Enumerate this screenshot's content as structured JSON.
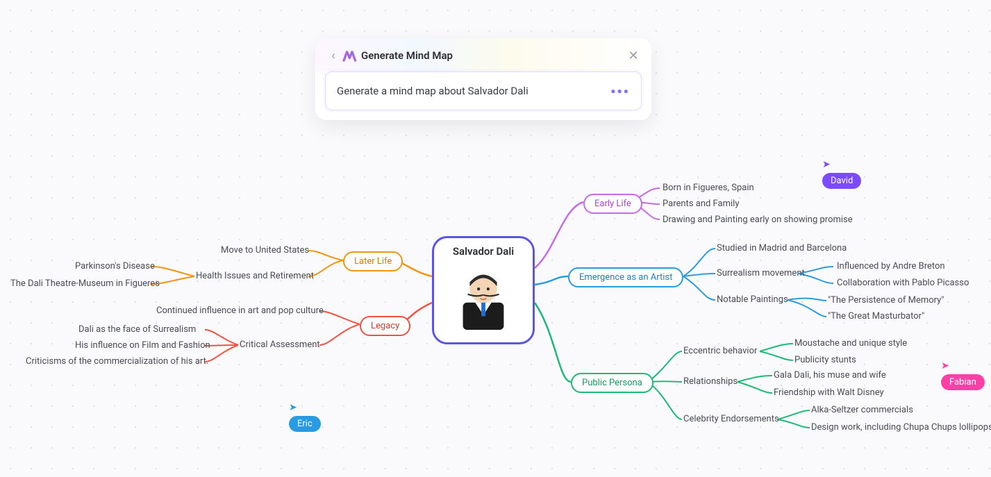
{
  "panel": {
    "title": "Generate Mind Map",
    "prompt": "Generate a mind map about Salvador Dali"
  },
  "center": {
    "title": "Salvador Dali"
  },
  "branches": {
    "early_life": {
      "label": "Early Life",
      "items": [
        "Born in Figueres, Spain",
        "Parents and Family",
        "Drawing and Painting early on showing promise"
      ]
    },
    "emergence": {
      "label": "Emergence as an Artist",
      "items": [
        "Studied in Madrid and Barcelona",
        "Surrealism movement",
        "Notable Paintings"
      ],
      "surrealism_sub": [
        "Influenced by Andre Breton",
        "Collaboration with Pablo Picasso"
      ],
      "paintings_sub": [
        "\"The Persistence of Memory\"",
        "\"The Great Masturbator\""
      ]
    },
    "public_persona": {
      "label": "Public Persona",
      "items": [
        "Eccentric behavior",
        "Relationships",
        "Celebrity Endorsements"
      ],
      "eccentric_sub": [
        "Moustache and unique style",
        "Publicity stunts"
      ],
      "relationships_sub": [
        "Gala Dali, his muse and wife",
        "Friendship with Walt Disney"
      ],
      "endorsements_sub": [
        "Alka-Seltzer commercials",
        "Design work, including Chupa Chups lollipops"
      ]
    },
    "later_life": {
      "label": "Later Life",
      "items": [
        "Move to United States",
        "Health Issues and Retirement"
      ],
      "health_sub": [
        "Parkinson's Disease",
        "The Dali Theatre-Museum in Figueres"
      ]
    },
    "legacy": {
      "label": "Legacy",
      "items": [
        "Continued influence in art and pop culture",
        "Critical Assessment"
      ],
      "critical_sub": [
        "Dali as the face of Surrealism",
        "His influence on Film and Fashion",
        "Criticisms of the commercialization of his art."
      ]
    }
  },
  "cursors": {
    "david": {
      "name": "David",
      "color": "#7c4bff"
    },
    "fabian": {
      "name": "Fabian",
      "color": "#ff3fa8"
    },
    "eric": {
      "name": "Eric",
      "color": "#2a9be0"
    }
  }
}
